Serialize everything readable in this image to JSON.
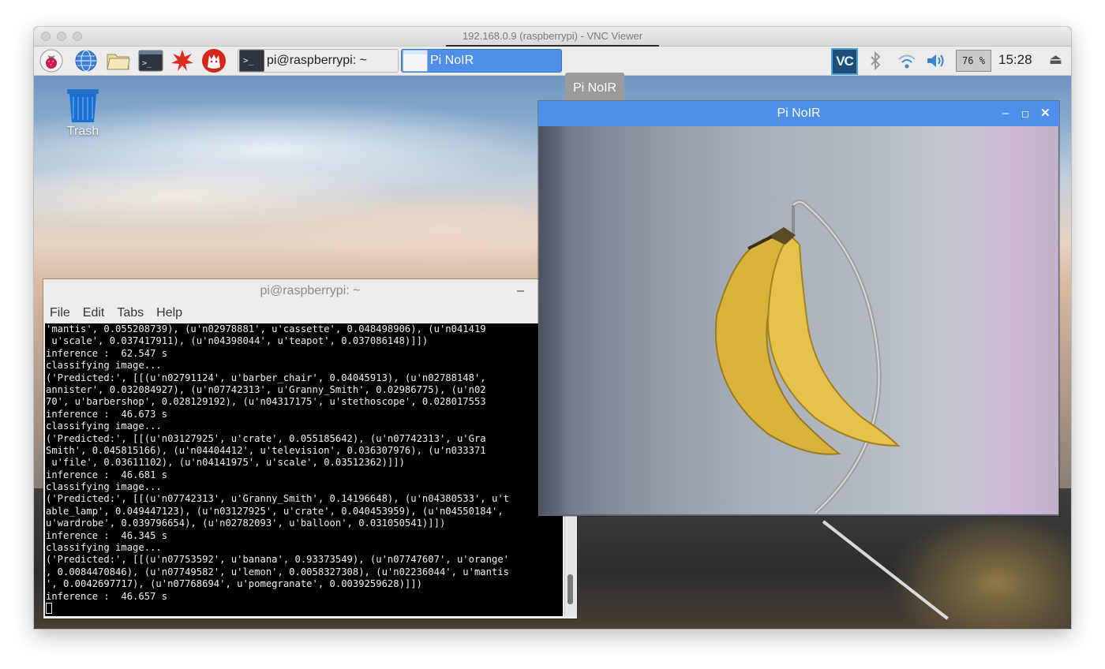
{
  "mac_window": {
    "title": "192.168.0.9 (raspberrypi) - VNC Viewer"
  },
  "taskbar": {
    "tasks": [
      {
        "label": "pi@raspberrypi: ~",
        "active": false
      },
      {
        "label": "Pi NoIR",
        "active": true
      }
    ],
    "tooltip": "Pi NoIR",
    "cpu_usage": "76 %",
    "clock": "15:28",
    "vnc_logo": "VC"
  },
  "desktop": {
    "trash_label": "Trash"
  },
  "terminal": {
    "title": "pi@raspberrypi: ~",
    "menu": [
      "File",
      "Edit",
      "Tabs",
      "Help"
    ],
    "lines": [
      "'mantis', 0.055208739), (u'n02978881', u'cassette', 0.048498906), (u'n041419",
      " u'scale', 0.037417911), (u'n04398044', u'teapot', 0.037086148)]])",
      "inference :  62.547 s",
      "classifying image...",
      "('Predicted:', [[(u'n02791124', u'barber_chair', 0.04045913), (u'n02788148',",
      "annister', 0.032084927), (u'n07742313', u'Granny_Smith', 0.02986775), (u'n02",
      "70', u'barbershop', 0.028129192), (u'n04317175', u'stethoscope', 0.028017553",
      "inference :  46.673 s",
      "classifying image...",
      "('Predicted:', [[(u'n03127925', u'crate', 0.055185642), (u'n07742313', u'Gra",
      "Smith', 0.045815166), (u'n04404412', u'television', 0.036307976), (u'n033371",
      " u'file', 0.03611102), (u'n04141975', u'scale', 0.03512362)]])",
      "inference :  46.681 s",
      "classifying image...",
      "('Predicted:', [[(u'n07742313', u'Granny_Smith', 0.14196648), (u'n04380533', u't",
      "able_lamp', 0.049447123), (u'n03127925', u'crate', 0.040453959), (u'n04550184',",
      "u'wardrobe', 0.039796654), (u'n02782093', u'balloon', 0.031050541)]])",
      "inference :  46.345 s",
      "classifying image...",
      "('Predicted:', [[(u'n07753592', u'banana', 0.93373549), (u'n07747607', u'orange'",
      ", 0.0084470846), (u'n07749582', u'lemon', 0.0058327308), (u'n02236044', u'mantis",
      "', 0.0042697717), (u'n07768694', u'pomegranate', 0.0039259628)]])",
      "inference :  46.657 s"
    ]
  },
  "pi_noir": {
    "title": "Pi NoIR"
  },
  "colors": {
    "taskbar_active": "#4d8fea",
    "terminal_bg": "#000000",
    "terminal_fg": "#f0f0f0"
  }
}
